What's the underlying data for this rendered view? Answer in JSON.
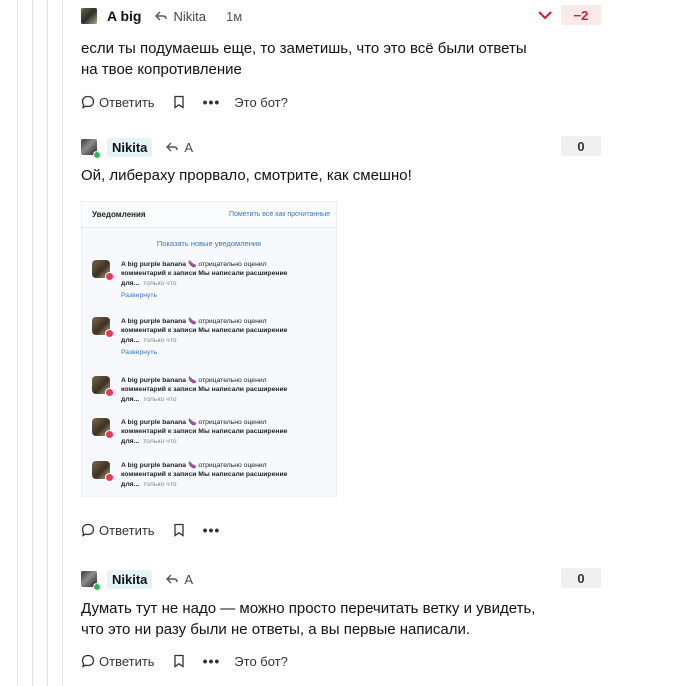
{
  "colors": {
    "accent_red": "#d21e2d",
    "online": "#1fbf56",
    "link_blue": "#3a76c4"
  },
  "comments": [
    {
      "author": "A big",
      "reply_to": "Nikita",
      "time": "1м",
      "score": "−2",
      "text": "если ты подумаешь еще, то заметишь, что это всё были ответы на твое копротивление",
      "actions": {
        "reply": "Ответить",
        "bot": "Это бот?"
      }
    },
    {
      "author": "Nikita",
      "reply_to": "A",
      "score": "0",
      "text": "Ой, либераху прорвало, смотрите, как смешно!",
      "actions": {
        "reply": "Ответить"
      }
    },
    {
      "author": "Nikita",
      "reply_to": "A",
      "score": "0",
      "text": "Думать тут не надо — можно просто перечитать ветку и увидеть, что это ни разу были не ответы, а вы первые написали.",
      "actions": {
        "reply": "Ответить",
        "bot": "Это бот?"
      }
    }
  ],
  "embedded_image": {
    "title": "Уведомления",
    "mark_all": "Пометить все как прочитанные",
    "show_new": "Показать новые уведомления",
    "notification": {
      "name": "A big purple banana",
      "emoji": "🍆",
      "line1_rest": "отрицательно оценил",
      "line2": "комментарий к записи Мы написали расширение",
      "line3": "для...",
      "time": "только что",
      "expand": "Развернуть"
    }
  }
}
